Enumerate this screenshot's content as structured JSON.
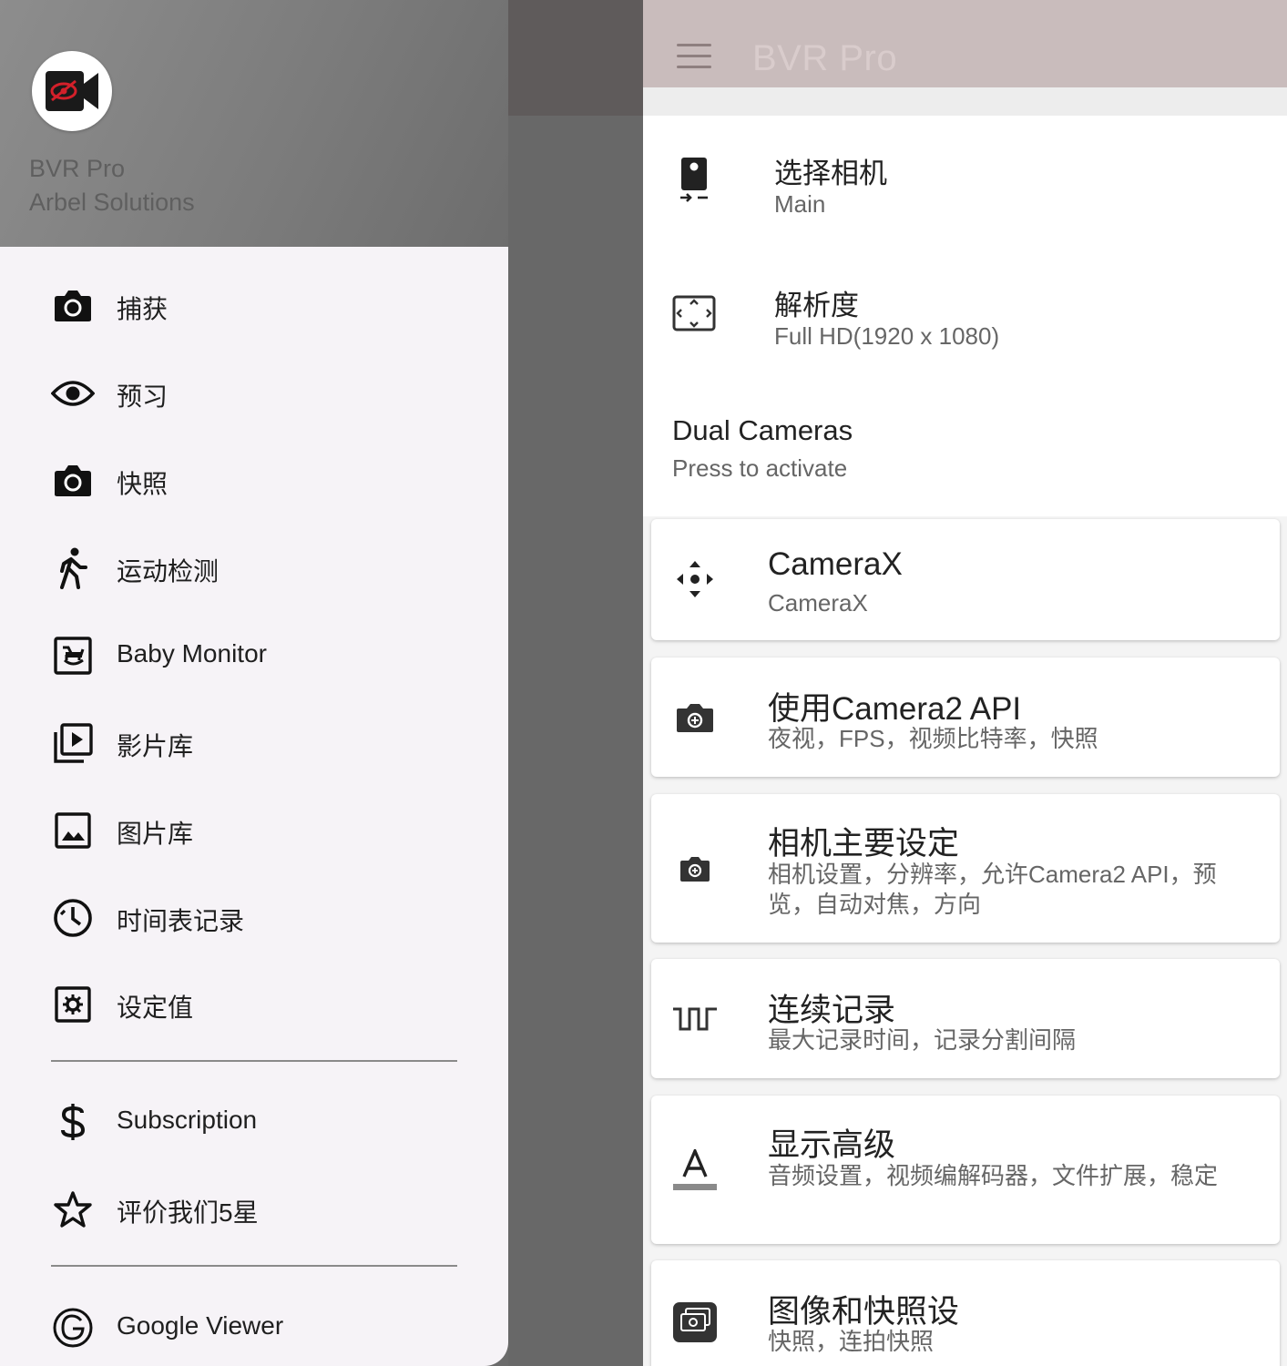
{
  "app": {
    "title": "BVR Pro",
    "developer": "Arbel Solutions"
  },
  "drawer": {
    "items": [
      {
        "label": "捕获",
        "icon": "camera-icon"
      },
      {
        "label": "预习",
        "icon": "eye-icon"
      },
      {
        "label": "快照",
        "icon": "camera-icon"
      },
      {
        "label": "运动检测",
        "icon": "walking-person-icon"
      },
      {
        "label": "Baby Monitor",
        "icon": "rocking-horse-icon"
      },
      {
        "label": "影片库",
        "icon": "video-library-icon"
      },
      {
        "label": "图片库",
        "icon": "image-icon"
      },
      {
        "label": "时间表记录",
        "icon": "schedule-clock-icon"
      },
      {
        "label": "设定值",
        "icon": "settings-box-icon"
      }
    ],
    "secondary": [
      {
        "label": "Subscription",
        "icon": "dollar-icon"
      },
      {
        "label": "评价我们5星",
        "icon": "star-outline-icon"
      }
    ],
    "tertiary": [
      {
        "label": "Google Viewer",
        "icon": "google-icon"
      }
    ]
  },
  "settings": {
    "toolbar_title": "BVR Pro",
    "select_camera": {
      "title": "选择相机",
      "value": "Main"
    },
    "resolution": {
      "title": "解析度",
      "value": "Full HD(1920 x 1080)"
    },
    "dual_cameras": {
      "title": "Dual Cameras",
      "subtitle": "Press to activate"
    },
    "cards": [
      {
        "title": "CameraX",
        "subtitle": "CameraX",
        "icon": "move-arrows-icon"
      },
      {
        "title": "使用Camera2 API",
        "subtitle": "夜视，FPS，视频比特率，快照",
        "icon": "camera-switch-icon"
      },
      {
        "title": "相机主要设定",
        "subtitle": "相机设置，分辨率，允许Camera2 API，预览，自动对焦，方向",
        "icon": "camera-settings-icon"
      },
      {
        "title": "连续记录",
        "subtitle": "最大记录时间，记录分割间隔",
        "icon": "pulse-wave-icon"
      },
      {
        "title": "显示高级",
        "subtitle": "音频设置，视频编解码器，文件扩展，稳定",
        "icon": "text-format-icon"
      },
      {
        "title": "图像和快照设",
        "subtitle": "快照，连拍快照",
        "icon": "photo-stack-icon"
      }
    ]
  },
  "colors": {
    "drawer_bg": "#f6f3f7",
    "header_bg": "#7c7c7c",
    "appbar_bg": "#c9bcbc",
    "brand_red": "#d3202a"
  }
}
